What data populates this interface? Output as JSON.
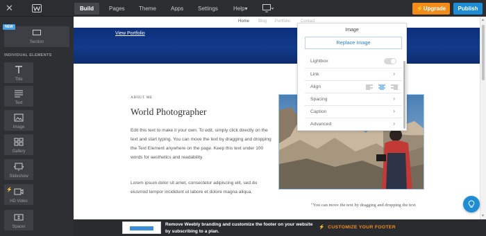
{
  "topbar": {
    "tabs": [
      {
        "label": "Build"
      },
      {
        "label": "Pages"
      },
      {
        "label": "Theme"
      },
      {
        "label": "Apps"
      },
      {
        "label": "Settings"
      },
      {
        "label": "Help",
        "suffix": "▾"
      }
    ],
    "active_tab": "Build",
    "upgrade_label": "Upgrade",
    "publish_label": "Publish",
    "colors": {
      "upgrade": "#f18c1b",
      "publish": "#1f8dd6",
      "bar": "#2c2d31"
    },
    "icons": {
      "close": "close-icon",
      "logo": "weebly-logo",
      "device": "monitor-icon"
    }
  },
  "sidebar": {
    "new_badge": "NEW",
    "section_label": "Section",
    "heading": "INDIVIDUAL ELEMENTS",
    "elements": [
      {
        "label": "Title",
        "icon": "title-icon"
      },
      {
        "label": "Text",
        "icon": "text-icon"
      },
      {
        "label": "Image",
        "icon": "image-icon"
      },
      {
        "label": "Gallery",
        "icon": "gallery-icon"
      },
      {
        "label": "Slideshow",
        "icon": "slideshow-icon"
      },
      {
        "label": "HD Video",
        "icon": "video-icon",
        "premium": true
      },
      {
        "label": "Spacer",
        "icon": "spacer-icon"
      }
    ]
  },
  "site": {
    "nav_links": [
      "Home",
      "Blog",
      "Portfolio",
      "Contact"
    ],
    "view_portfolio": "View Portfolio",
    "about_me": "ABOUT ME",
    "heading": "World Photographer",
    "paragraph1": "Edit this text to make it your own. To edit, simply click directly on the text and start typing. You can move the text by dragging and dropping the Text Element anywhere on the page. Keep this text under 100 words for aesthetics and readability.",
    "paragraph2": "Lorem ipsum dolor sit amet, consectetur adipiscing elit, sed do eiusmod tempor incididunt ut labore et dolore magna aliqua.",
    "quote": "\"You can move the text by dragging and dropping the text"
  },
  "image_panel": {
    "title": "Image",
    "replace_label": "Replace Image",
    "rows": [
      {
        "label": "Lightbox",
        "control": "toggle",
        "on": false
      },
      {
        "label": "Link",
        "control": "chevron"
      },
      {
        "label": "Align",
        "control": "align",
        "selected": "center"
      },
      {
        "label": "Spacing",
        "control": "chevron"
      },
      {
        "label": "Caption",
        "control": "chevron"
      },
      {
        "label": "Advanced",
        "control": "chevron"
      }
    ],
    "chevron_glyph": "›"
  },
  "promo": {
    "text": "Remove Weebly branding and customize the footer on your website by subscribing to a plan.",
    "cta": "CUSTOMIZE YOUR FOOTER",
    "cta_icon": "bolt-icon"
  },
  "help": {
    "icon": "lightbulb-icon"
  }
}
